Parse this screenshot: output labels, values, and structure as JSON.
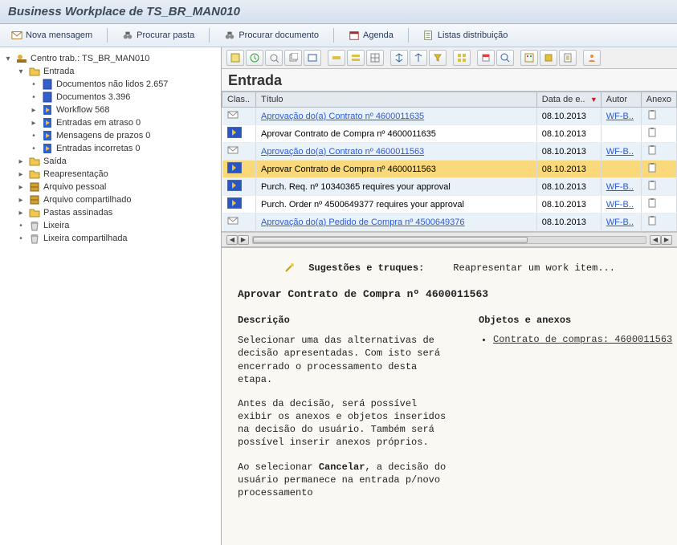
{
  "window": {
    "title": "Business Workplace de TS_BR_MAN010"
  },
  "toolbar": {
    "new_msg": "Nova mensagem",
    "find_folder": "Procurar pasta",
    "find_doc": "Procurar documento",
    "agenda": "Agenda",
    "dist_lists": "Listas distribuição"
  },
  "tree": {
    "root": "Centro trab.: TS_BR_MAN010",
    "inbox": "Entrada",
    "unread": "Documentos não lidos 2.657",
    "docs": "Documentos 3.396",
    "workflow": "Workflow 568",
    "overdue": "Entradas em atraso 0",
    "deadline": "Mensagens de prazos 0",
    "incorrect": "Entradas incorretas 0",
    "outbox": "Saída",
    "resubmit": "Reapresentação",
    "private": "Arquivo pessoal",
    "shared": "Arquivo compartilhado",
    "subscribed": "Pastas assinadas",
    "trash": "Lixeira",
    "shared_trash": "Lixeira compartilhada"
  },
  "grid": {
    "heading": "Entrada",
    "cols": {
      "clas": "Clas..",
      "title": "Título",
      "date": "Data de e..",
      "author": "Autor",
      "attach": "Anexo"
    },
    "rows": [
      {
        "title": "Aprovação do(a) Contrato nº 4600011635",
        "date": "08.10.2013",
        "author": "WF-B..",
        "link": true
      },
      {
        "title": "Aprovar Contrato de Compra nº 4600011635",
        "date": "08.10.2013",
        "author": "",
        "link": false
      },
      {
        "title": "Aprovação do(a) Contrato nº 4600011563",
        "date": "08.10.2013",
        "author": "WF-B..",
        "link": true
      },
      {
        "title": "Aprovar Contrato de Compra nº 4600011563",
        "date": "08.10.2013",
        "author": "",
        "link": false,
        "selected": true
      },
      {
        "title": "Purch. Req. nº 10340365 requires your approval",
        "date": "08.10.2013",
        "author": "WF-B..",
        "link": false
      },
      {
        "title": "Purch. Order nº 4500649377 requires your approval",
        "date": "08.10.2013",
        "author": "WF-B..",
        "link": false
      },
      {
        "title": "Aprovação do(a) Pedido de Compra nº 4500649376",
        "date": "08.10.2013",
        "author": "WF-B..",
        "link": true
      }
    ]
  },
  "preview": {
    "tip_label": "Sugestões e truques:",
    "tip_action": "Reapresentar um work item...",
    "item_title": "Aprovar Contrato de Compra nº 4600011563",
    "desc_heading": "Descrição",
    "desc_p1": "Selecionar uma das alternativas de decisão apresentadas. Com isto será encerrado o processamento desta etapa.",
    "desc_p2": "Antes da decisão, será possível exibir os anexos e objetos inseridos na decisão do usuário. Também será possível inserir anexos próprios.",
    "desc_p3a": "Ao selecionar ",
    "desc_p3b": "Cancelar",
    "desc_p3c": ", a decisão do usuário permanece na entrada p/novo processamento",
    "obj_heading": "Objetos e anexos",
    "obj_link": "Contrato de compras: 4600011563"
  }
}
